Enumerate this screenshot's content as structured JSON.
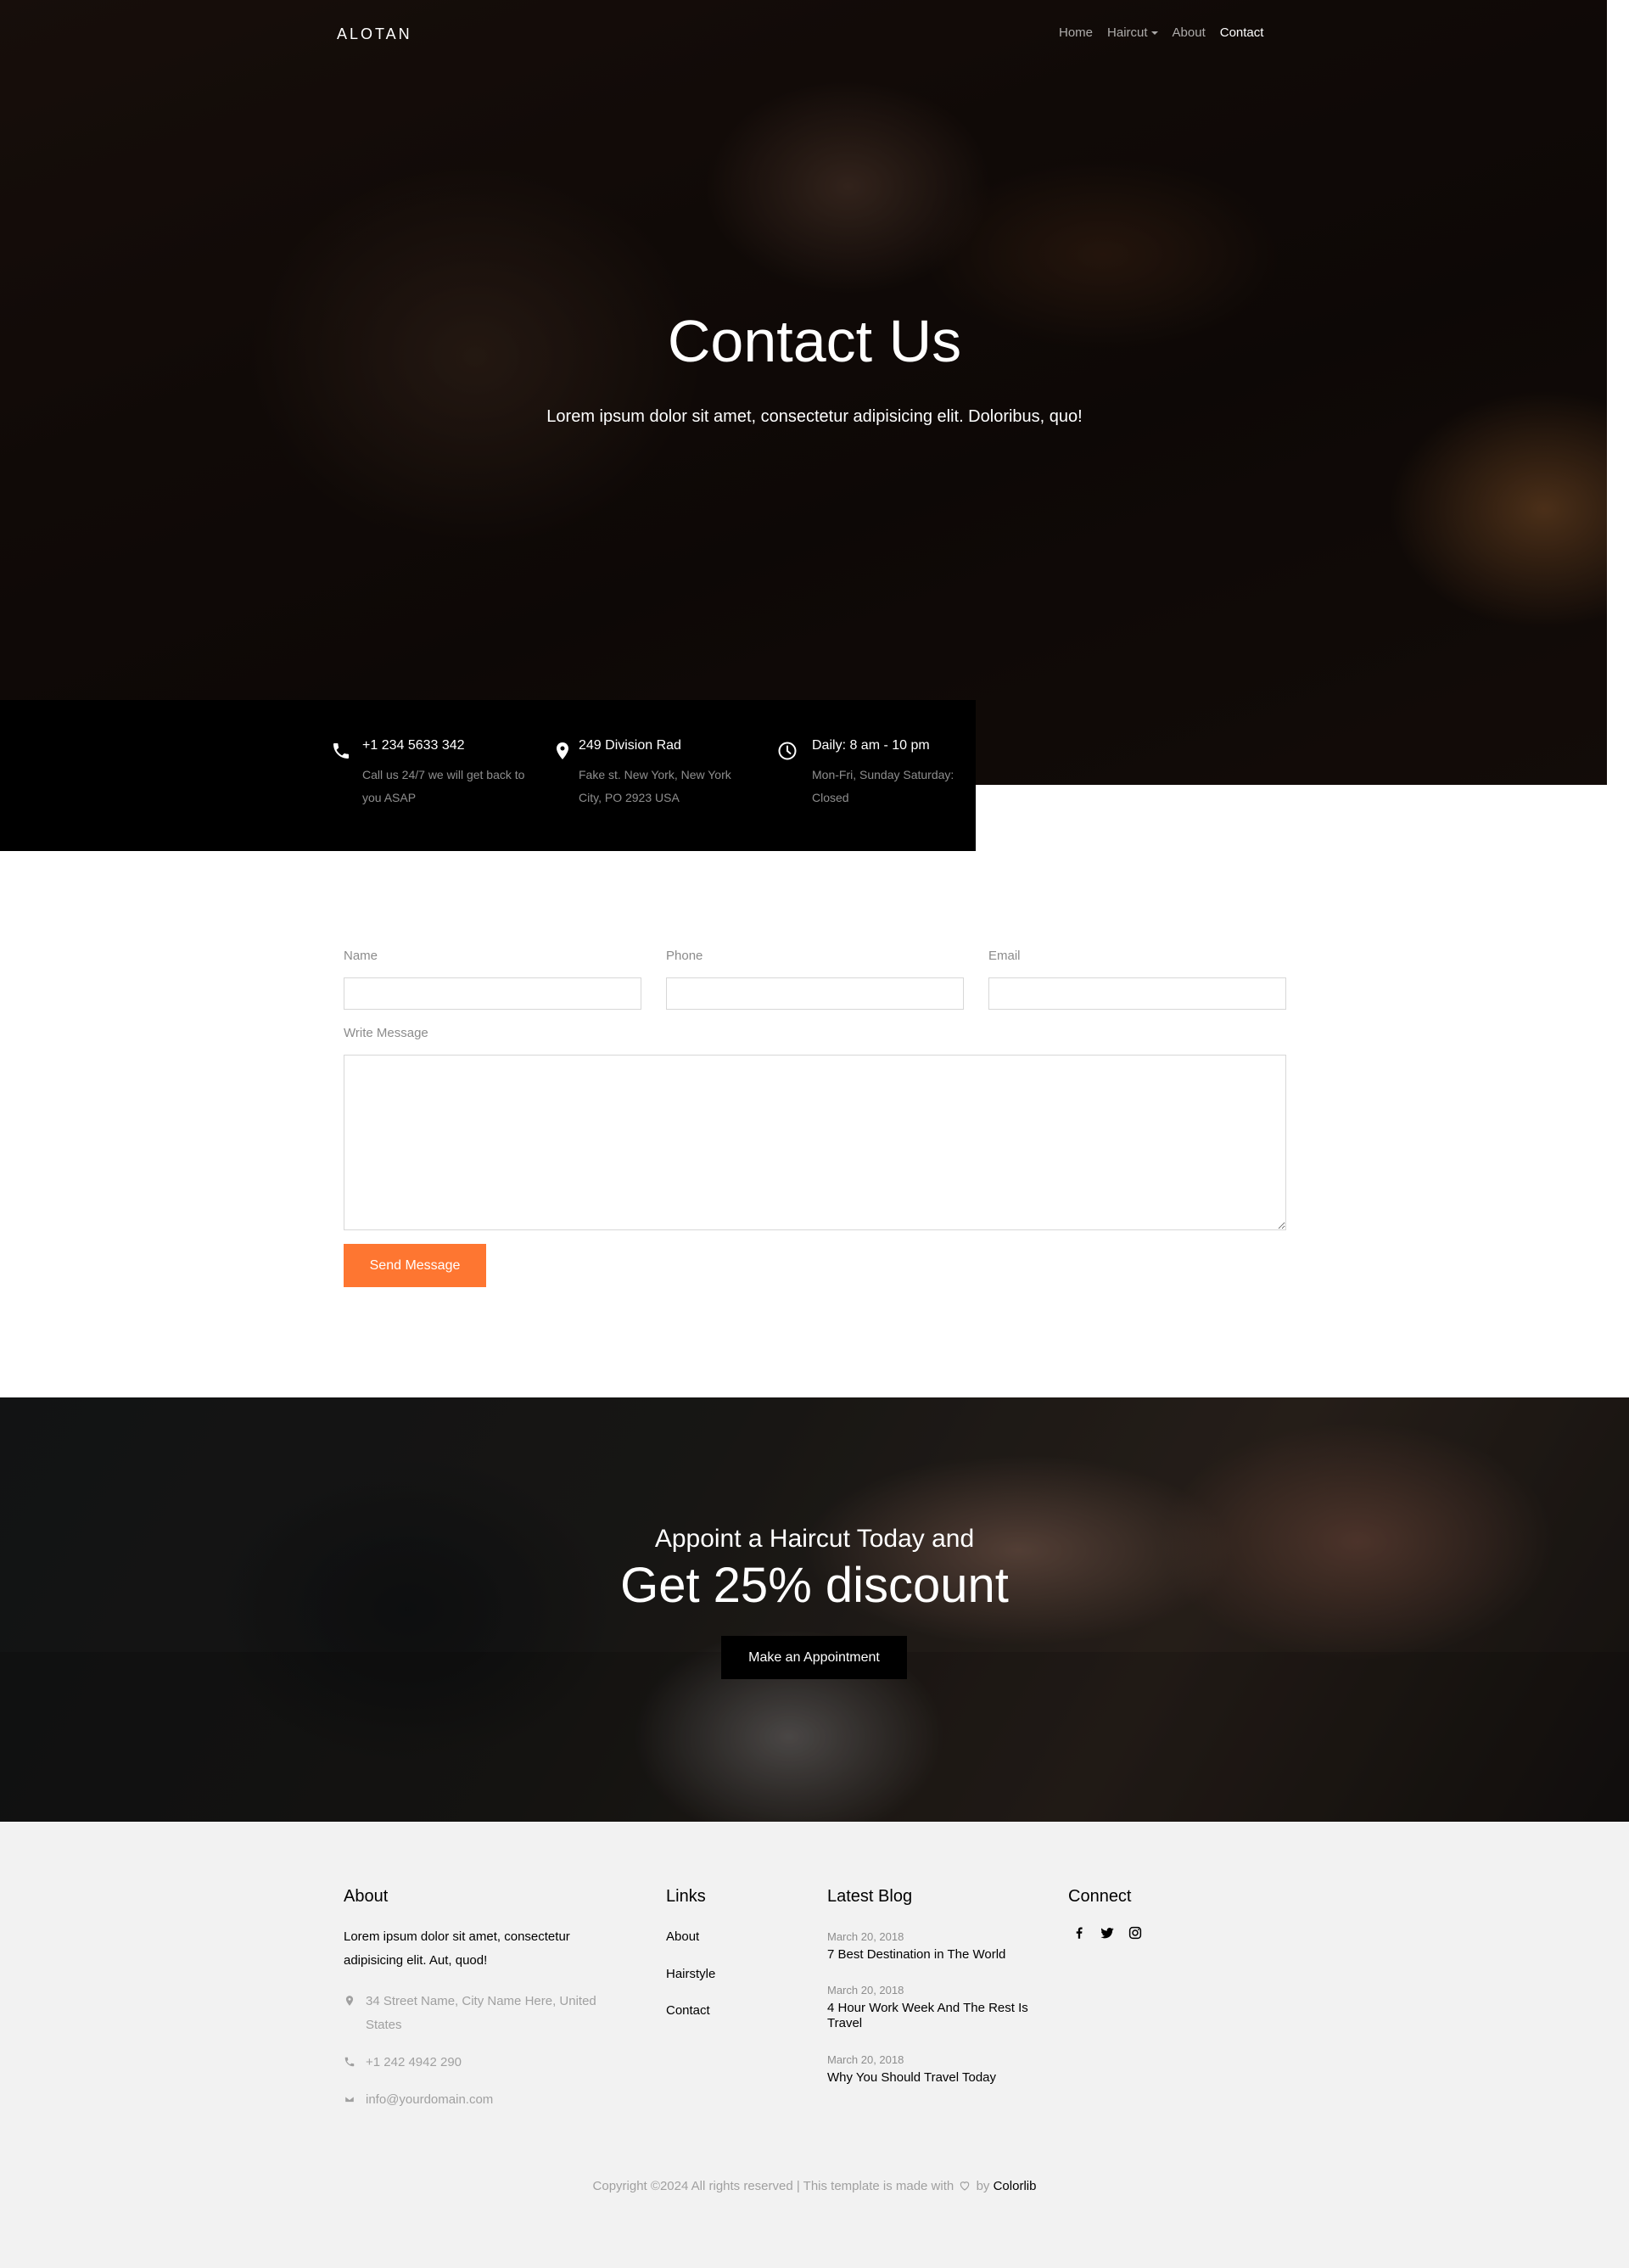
{
  "nav": {
    "logo": "ALOTAN",
    "links": [
      {
        "label": "Home"
      },
      {
        "label": "Haircut"
      },
      {
        "label": "About"
      },
      {
        "label": "Contact"
      }
    ]
  },
  "hero": {
    "title": "Contact Us",
    "subtitle": "Lorem ipsum dolor sit amet, consectetur adipisicing elit. Doloribus, quo!"
  },
  "info": [
    {
      "icon": "phone-icon",
      "title": "+1 234 5633 342",
      "text": "Call us 24/7 we will get back to you ASAP"
    },
    {
      "icon": "map-marker-icon",
      "title": "249 Division Rad",
      "text": "Fake st. New York, New York City, PO 2923 USA"
    },
    {
      "icon": "clock-icon",
      "title": "Daily: 8 am - 10 pm",
      "text": "Mon-Fri, Sunday Saturday: Closed"
    }
  ],
  "form": {
    "name_label": "Name",
    "phone_label": "Phone",
    "email_label": "Email",
    "message_label": "Write Message",
    "name_value": "",
    "phone_value": "",
    "email_value": "",
    "message_value": "",
    "send_label": "Send Message"
  },
  "cta": {
    "subtitle": "Appoint a Haircut Today and",
    "title": "Get 25% discount",
    "button": "Make an Appointment"
  },
  "footer": {
    "about": {
      "heading": "About",
      "text": "Lorem ipsum dolor sit amet, consectetur adipisicing elit. Aut, quod!",
      "address": "34 Street Name, City Name Here, United States",
      "phone": "+1 242 4942 290",
      "email": "info@yourdomain.com"
    },
    "links": {
      "heading": "Links",
      "items": [
        "About",
        "Hairstyle",
        "Contact"
      ]
    },
    "blog": {
      "heading": "Latest Blog",
      "items": [
        {
          "date": "March 20, 2018",
          "title": "7 Best Destination in The World"
        },
        {
          "date": "March 20, 2018",
          "title": "4 Hour Work Week And The Rest Is Travel"
        },
        {
          "date": "March 20, 2018",
          "title": "Why You Should Travel Today"
        }
      ]
    },
    "connect": {
      "heading": "Connect",
      "icons": [
        "facebook-icon",
        "twitter-icon",
        "instagram-icon"
      ]
    },
    "copyright_prefix": "Copyright ©2024 All rights reserved | This template is made with",
    "copyright_by": "by",
    "copyright_brand": "Colorlib"
  },
  "colors": {
    "accent": "#fe7631",
    "dark": "#000000",
    "footer_bg": "#f2f2f2"
  }
}
